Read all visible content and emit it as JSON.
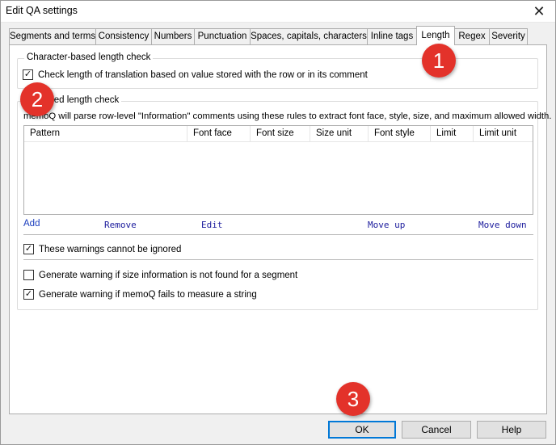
{
  "window": {
    "title": "Edit QA settings",
    "close_glyph": "✕"
  },
  "tabs": [
    {
      "label": "Segments and terms"
    },
    {
      "label": "Consistency"
    },
    {
      "label": "Numbers"
    },
    {
      "label": "Punctuation"
    },
    {
      "label": "Spaces, capitals, characters"
    },
    {
      "label": "Inline tags"
    },
    {
      "label": "Length",
      "active": true
    },
    {
      "label": "Regex"
    },
    {
      "label": "Severity"
    }
  ],
  "char_group": {
    "label": "Character-based length check",
    "check_label": "Check length of translation based on value stored with the row or in its comment",
    "checked": true
  },
  "pixel_group": {
    "label_visible": "sed length check",
    "description": "memoQ will parse row-level \"Information\" comments using these rules to extract font face, style, size, and maximum allowed width.",
    "columns": [
      "Pattern",
      "Font face",
      "Font size",
      "Size unit",
      "Font style",
      "Limit",
      "Limit unit"
    ],
    "rows": [],
    "actions": {
      "add": "Add",
      "remove": "Remove",
      "edit": "Edit",
      "move_up": "Move up",
      "move_down": "Move down"
    },
    "cannot_ignore": {
      "label": "These warnings cannot be ignored",
      "checked": true
    },
    "no_size_info": {
      "label": "Generate warning if size information is not found for a segment",
      "checked": false
    },
    "measure_fail": {
      "label": "Generate warning if memoQ fails to measure a string",
      "checked": true
    }
  },
  "buttons": {
    "ok": "OK",
    "cancel": "Cancel",
    "help": "Help"
  },
  "callouts": {
    "one": "1",
    "two": "2",
    "three": "3"
  },
  "colors": {
    "accent": "#0078d7",
    "callout": "#e3322a",
    "link": "#1a1a9c"
  },
  "icons": {
    "checked": "✓"
  }
}
